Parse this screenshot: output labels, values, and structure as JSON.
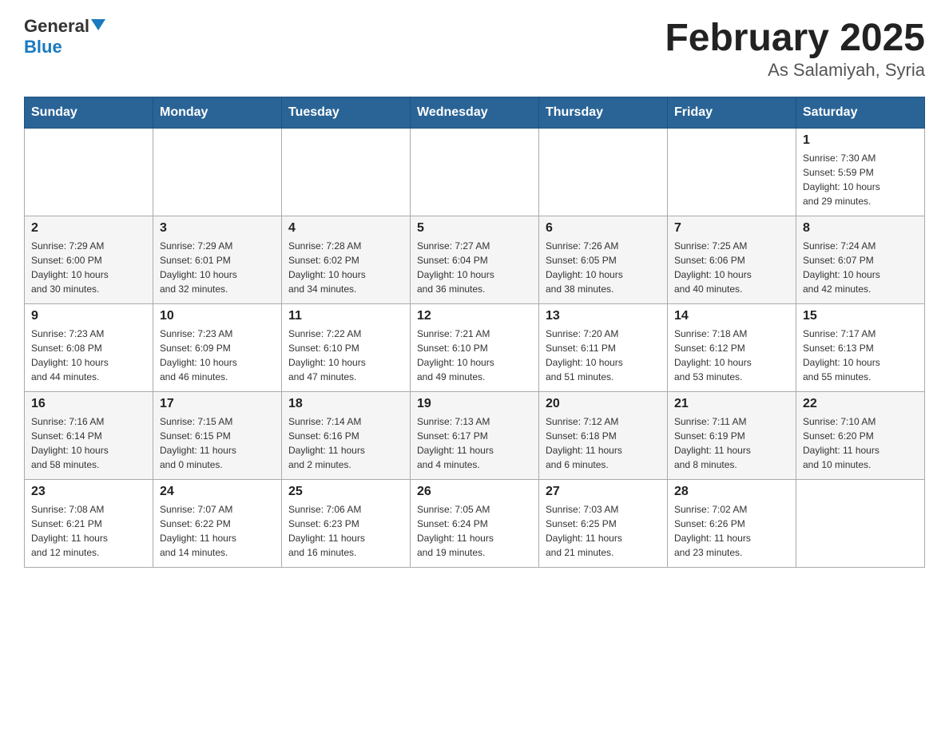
{
  "header": {
    "title": "February 2025",
    "subtitle": "As Salamiyah, Syria",
    "logo_general": "General",
    "logo_blue": "Blue"
  },
  "days_of_week": [
    "Sunday",
    "Monday",
    "Tuesday",
    "Wednesday",
    "Thursday",
    "Friday",
    "Saturday"
  ],
  "weeks": [
    [
      {
        "day": "",
        "info": ""
      },
      {
        "day": "",
        "info": ""
      },
      {
        "day": "",
        "info": ""
      },
      {
        "day": "",
        "info": ""
      },
      {
        "day": "",
        "info": ""
      },
      {
        "day": "",
        "info": ""
      },
      {
        "day": "1",
        "info": "Sunrise: 7:30 AM\nSunset: 5:59 PM\nDaylight: 10 hours\nand 29 minutes."
      }
    ],
    [
      {
        "day": "2",
        "info": "Sunrise: 7:29 AM\nSunset: 6:00 PM\nDaylight: 10 hours\nand 30 minutes."
      },
      {
        "day": "3",
        "info": "Sunrise: 7:29 AM\nSunset: 6:01 PM\nDaylight: 10 hours\nand 32 minutes."
      },
      {
        "day": "4",
        "info": "Sunrise: 7:28 AM\nSunset: 6:02 PM\nDaylight: 10 hours\nand 34 minutes."
      },
      {
        "day": "5",
        "info": "Sunrise: 7:27 AM\nSunset: 6:04 PM\nDaylight: 10 hours\nand 36 minutes."
      },
      {
        "day": "6",
        "info": "Sunrise: 7:26 AM\nSunset: 6:05 PM\nDaylight: 10 hours\nand 38 minutes."
      },
      {
        "day": "7",
        "info": "Sunrise: 7:25 AM\nSunset: 6:06 PM\nDaylight: 10 hours\nand 40 minutes."
      },
      {
        "day": "8",
        "info": "Sunrise: 7:24 AM\nSunset: 6:07 PM\nDaylight: 10 hours\nand 42 minutes."
      }
    ],
    [
      {
        "day": "9",
        "info": "Sunrise: 7:23 AM\nSunset: 6:08 PM\nDaylight: 10 hours\nand 44 minutes."
      },
      {
        "day": "10",
        "info": "Sunrise: 7:23 AM\nSunset: 6:09 PM\nDaylight: 10 hours\nand 46 minutes."
      },
      {
        "day": "11",
        "info": "Sunrise: 7:22 AM\nSunset: 6:10 PM\nDaylight: 10 hours\nand 47 minutes."
      },
      {
        "day": "12",
        "info": "Sunrise: 7:21 AM\nSunset: 6:10 PM\nDaylight: 10 hours\nand 49 minutes."
      },
      {
        "day": "13",
        "info": "Sunrise: 7:20 AM\nSunset: 6:11 PM\nDaylight: 10 hours\nand 51 minutes."
      },
      {
        "day": "14",
        "info": "Sunrise: 7:18 AM\nSunset: 6:12 PM\nDaylight: 10 hours\nand 53 minutes."
      },
      {
        "day": "15",
        "info": "Sunrise: 7:17 AM\nSunset: 6:13 PM\nDaylight: 10 hours\nand 55 minutes."
      }
    ],
    [
      {
        "day": "16",
        "info": "Sunrise: 7:16 AM\nSunset: 6:14 PM\nDaylight: 10 hours\nand 58 minutes."
      },
      {
        "day": "17",
        "info": "Sunrise: 7:15 AM\nSunset: 6:15 PM\nDaylight: 11 hours\nand 0 minutes."
      },
      {
        "day": "18",
        "info": "Sunrise: 7:14 AM\nSunset: 6:16 PM\nDaylight: 11 hours\nand 2 minutes."
      },
      {
        "day": "19",
        "info": "Sunrise: 7:13 AM\nSunset: 6:17 PM\nDaylight: 11 hours\nand 4 minutes."
      },
      {
        "day": "20",
        "info": "Sunrise: 7:12 AM\nSunset: 6:18 PM\nDaylight: 11 hours\nand 6 minutes."
      },
      {
        "day": "21",
        "info": "Sunrise: 7:11 AM\nSunset: 6:19 PM\nDaylight: 11 hours\nand 8 minutes."
      },
      {
        "day": "22",
        "info": "Sunrise: 7:10 AM\nSunset: 6:20 PM\nDaylight: 11 hours\nand 10 minutes."
      }
    ],
    [
      {
        "day": "23",
        "info": "Sunrise: 7:08 AM\nSunset: 6:21 PM\nDaylight: 11 hours\nand 12 minutes."
      },
      {
        "day": "24",
        "info": "Sunrise: 7:07 AM\nSunset: 6:22 PM\nDaylight: 11 hours\nand 14 minutes."
      },
      {
        "day": "25",
        "info": "Sunrise: 7:06 AM\nSunset: 6:23 PM\nDaylight: 11 hours\nand 16 minutes."
      },
      {
        "day": "26",
        "info": "Sunrise: 7:05 AM\nSunset: 6:24 PM\nDaylight: 11 hours\nand 19 minutes."
      },
      {
        "day": "27",
        "info": "Sunrise: 7:03 AM\nSunset: 6:25 PM\nDaylight: 11 hours\nand 21 minutes."
      },
      {
        "day": "28",
        "info": "Sunrise: 7:02 AM\nSunset: 6:26 PM\nDaylight: 11 hours\nand 23 minutes."
      },
      {
        "day": "",
        "info": ""
      }
    ]
  ]
}
